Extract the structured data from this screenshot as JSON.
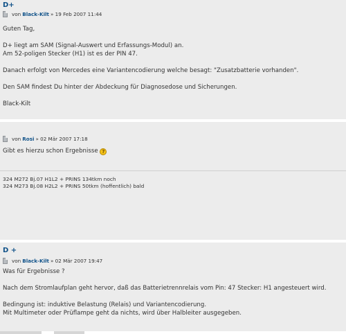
{
  "posts": [
    {
      "title": "D+",
      "author": "Black-Kilt",
      "date": "» 19 Feb 2007 11:44",
      "body": [
        "Guten Tag,",
        "D+ liegt am SAM (Signal-Auswert und Erfassungs-Modul) an.",
        "Am 52-poligen Stecker (H1) ist es der PIN 47.",
        "Danach erfolgt von Mercedes eine Variantencodierung welche besagt: \"Zusatzbatterie vorhanden\".",
        "Den SAM findest Du hinter der Abdeckung für Diagnosedose und Sicherungen.",
        "Black-Kilt"
      ]
    },
    {
      "title": "",
      "author": "Rosi",
      "date": "» 02 Mär 2007 17:18",
      "body": [
        "Gibt es hierzu schon Ergebnisse"
      ],
      "icon": "confused-smiley-icon",
      "signature": [
        "324 M272 Bj.07 H1L2 + PRINS 134tkm noch",
        "324 M273 Bj.08 H2L2 + PRINS 50tkm (hoffentlich) bald"
      ]
    },
    {
      "title": "D +",
      "author": "Black-Kilt",
      "date": "» 02 Mär 2007 19:47",
      "body": [
        "Was für Ergebnisse ?",
        "Nach dem Stromlaufplan geht hervor, daß das Batterietrennrelais vom Pin: 47 Stecker: H1 angesteuert wird.",
        "Bedingung ist: induktive Belastung (Relais) und Variantencodierung.",
        "Mit Multimeter oder Prüflampe geht da nichts, wird über Halbleiter ausgegeben."
      ]
    }
  ],
  "von_label": "von",
  "colors": {
    "post_bg": "#ececec",
    "link": "#105289"
  }
}
